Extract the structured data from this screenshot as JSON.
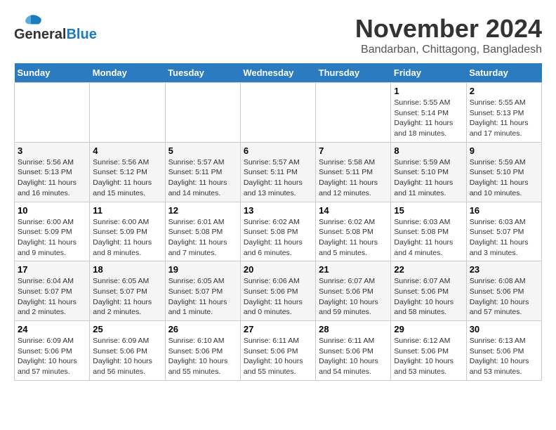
{
  "header": {
    "logo_general": "General",
    "logo_blue": "Blue",
    "month": "November 2024",
    "location": "Bandarban, Chittagong, Bangladesh"
  },
  "weekdays": [
    "Sunday",
    "Monday",
    "Tuesday",
    "Wednesday",
    "Thursday",
    "Friday",
    "Saturday"
  ],
  "weeks": [
    [
      {
        "day": "",
        "info": ""
      },
      {
        "day": "",
        "info": ""
      },
      {
        "day": "",
        "info": ""
      },
      {
        "day": "",
        "info": ""
      },
      {
        "day": "",
        "info": ""
      },
      {
        "day": "1",
        "info": "Sunrise: 5:55 AM\nSunset: 5:14 PM\nDaylight: 11 hours\nand 18 minutes."
      },
      {
        "day": "2",
        "info": "Sunrise: 5:55 AM\nSunset: 5:13 PM\nDaylight: 11 hours\nand 17 minutes."
      }
    ],
    [
      {
        "day": "3",
        "info": "Sunrise: 5:56 AM\nSunset: 5:13 PM\nDaylight: 11 hours\nand 16 minutes."
      },
      {
        "day": "4",
        "info": "Sunrise: 5:56 AM\nSunset: 5:12 PM\nDaylight: 11 hours\nand 15 minutes."
      },
      {
        "day": "5",
        "info": "Sunrise: 5:57 AM\nSunset: 5:11 PM\nDaylight: 11 hours\nand 14 minutes."
      },
      {
        "day": "6",
        "info": "Sunrise: 5:57 AM\nSunset: 5:11 PM\nDaylight: 11 hours\nand 13 minutes."
      },
      {
        "day": "7",
        "info": "Sunrise: 5:58 AM\nSunset: 5:11 PM\nDaylight: 11 hours\nand 12 minutes."
      },
      {
        "day": "8",
        "info": "Sunrise: 5:59 AM\nSunset: 5:10 PM\nDaylight: 11 hours\nand 11 minutes."
      },
      {
        "day": "9",
        "info": "Sunrise: 5:59 AM\nSunset: 5:10 PM\nDaylight: 11 hours\nand 10 minutes."
      }
    ],
    [
      {
        "day": "10",
        "info": "Sunrise: 6:00 AM\nSunset: 5:09 PM\nDaylight: 11 hours\nand 9 minutes."
      },
      {
        "day": "11",
        "info": "Sunrise: 6:00 AM\nSunset: 5:09 PM\nDaylight: 11 hours\nand 8 minutes."
      },
      {
        "day": "12",
        "info": "Sunrise: 6:01 AM\nSunset: 5:08 PM\nDaylight: 11 hours\nand 7 minutes."
      },
      {
        "day": "13",
        "info": "Sunrise: 6:02 AM\nSunset: 5:08 PM\nDaylight: 11 hours\nand 6 minutes."
      },
      {
        "day": "14",
        "info": "Sunrise: 6:02 AM\nSunset: 5:08 PM\nDaylight: 11 hours\nand 5 minutes."
      },
      {
        "day": "15",
        "info": "Sunrise: 6:03 AM\nSunset: 5:08 PM\nDaylight: 11 hours\nand 4 minutes."
      },
      {
        "day": "16",
        "info": "Sunrise: 6:03 AM\nSunset: 5:07 PM\nDaylight: 11 hours\nand 3 minutes."
      }
    ],
    [
      {
        "day": "17",
        "info": "Sunrise: 6:04 AM\nSunset: 5:07 PM\nDaylight: 11 hours\nand 2 minutes."
      },
      {
        "day": "18",
        "info": "Sunrise: 6:05 AM\nSunset: 5:07 PM\nDaylight: 11 hours\nand 2 minutes."
      },
      {
        "day": "19",
        "info": "Sunrise: 6:05 AM\nSunset: 5:07 PM\nDaylight: 11 hours\nand 1 minute."
      },
      {
        "day": "20",
        "info": "Sunrise: 6:06 AM\nSunset: 5:06 PM\nDaylight: 11 hours\nand 0 minutes."
      },
      {
        "day": "21",
        "info": "Sunrise: 6:07 AM\nSunset: 5:06 PM\nDaylight: 10 hours\nand 59 minutes."
      },
      {
        "day": "22",
        "info": "Sunrise: 6:07 AM\nSunset: 5:06 PM\nDaylight: 10 hours\nand 58 minutes."
      },
      {
        "day": "23",
        "info": "Sunrise: 6:08 AM\nSunset: 5:06 PM\nDaylight: 10 hours\nand 57 minutes."
      }
    ],
    [
      {
        "day": "24",
        "info": "Sunrise: 6:09 AM\nSunset: 5:06 PM\nDaylight: 10 hours\nand 57 minutes."
      },
      {
        "day": "25",
        "info": "Sunrise: 6:09 AM\nSunset: 5:06 PM\nDaylight: 10 hours\nand 56 minutes."
      },
      {
        "day": "26",
        "info": "Sunrise: 6:10 AM\nSunset: 5:06 PM\nDaylight: 10 hours\nand 55 minutes."
      },
      {
        "day": "27",
        "info": "Sunrise: 6:11 AM\nSunset: 5:06 PM\nDaylight: 10 hours\nand 55 minutes."
      },
      {
        "day": "28",
        "info": "Sunrise: 6:11 AM\nSunset: 5:06 PM\nDaylight: 10 hours\nand 54 minutes."
      },
      {
        "day": "29",
        "info": "Sunrise: 6:12 AM\nSunset: 5:06 PM\nDaylight: 10 hours\nand 53 minutes."
      },
      {
        "day": "30",
        "info": "Sunrise: 6:13 AM\nSunset: 5:06 PM\nDaylight: 10 hours\nand 53 minutes."
      }
    ]
  ]
}
